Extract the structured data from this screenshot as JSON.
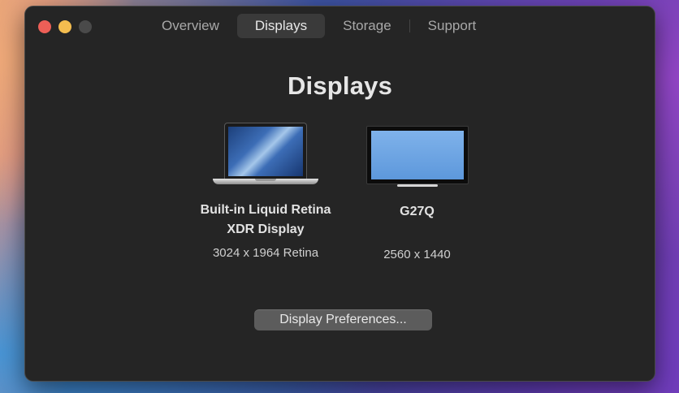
{
  "tabs": [
    {
      "label": "Overview",
      "active": false
    },
    {
      "label": "Displays",
      "active": true
    },
    {
      "label": "Storage",
      "active": false
    },
    {
      "label": "Support",
      "active": false
    }
  ],
  "page_title": "Displays",
  "displays": [
    {
      "icon": "laptop-icon",
      "name_line1": "Built-in Liquid Retina",
      "name_line2": "XDR Display",
      "resolution": "3024 x 1964 Retina"
    },
    {
      "icon": "monitor-icon",
      "name_line1": "G27Q",
      "name_line2": "",
      "resolution": "2560 x 1440"
    }
  ],
  "preferences_button": "Display Preferences...",
  "colors": {
    "window_bg": "#252525",
    "close": "#ed5f57",
    "minimize": "#f4bd4f",
    "zoom_disabled": "#4a4a4a",
    "active_tab_bg": "#3a3a3a",
    "button_bg": "#5c5c5c"
  }
}
